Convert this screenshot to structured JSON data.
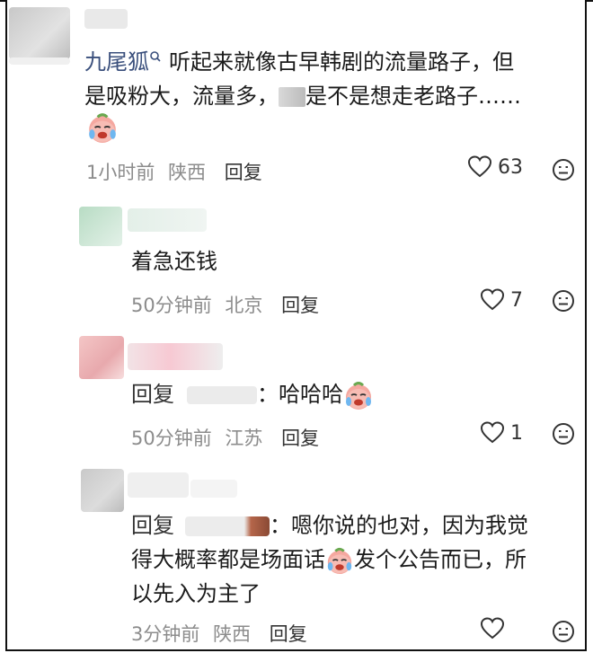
{
  "comments": [
    {
      "username": "九尾狐",
      "text_line1": "听起来就像古早韩剧的流量路子，但",
      "text_line2a": "是吸粉大，流量多，",
      "text_line2b": "是不是想走老路子……",
      "time": "1小时前",
      "location": "陕西",
      "reply_label": "回复",
      "likes": "63"
    },
    {
      "text": "着急还钱",
      "time": "50分钟前",
      "location": "北京",
      "reply_label": "回复",
      "likes": "7"
    },
    {
      "reply_prefix": "回复",
      "colon": "：",
      "text": "哈哈哈",
      "time": "50分钟前",
      "location": "江苏",
      "reply_label": "回复",
      "likes": "1"
    },
    {
      "reply_prefix": "回复",
      "colon": "：",
      "text_line1": "嗯你说的也对，因为我觉",
      "text_line2a": "得大概率都是场面话",
      "text_line2b": "发个公告而已，所",
      "text_line3": "以先入为主了",
      "time": "3分钟前",
      "location": "陕西",
      "reply_label": "回复"
    }
  ],
  "icons": {
    "like": "heart-outline-icon",
    "dislike": "frown-face-icon",
    "emoji": "crying-laughing-emoji",
    "verified": "verified-badge-icon"
  },
  "colors": {
    "username": "#3a4f7c",
    "meta": "#8c8c8c"
  }
}
